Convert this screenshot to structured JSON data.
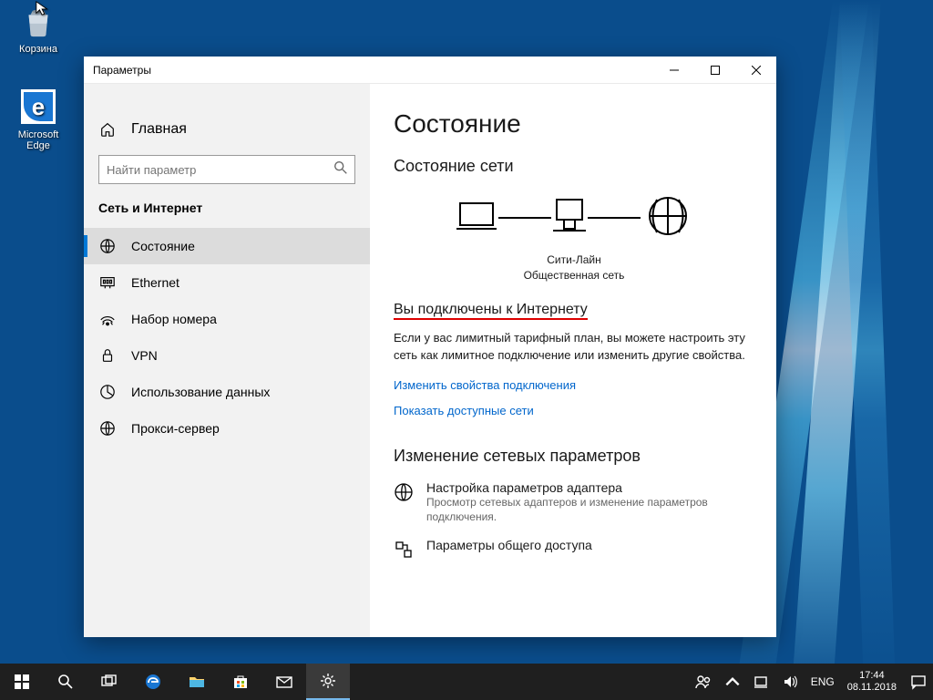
{
  "desktop": {
    "recycle_label": "Корзина",
    "edge_label": "Microsoft Edge"
  },
  "window": {
    "title": "Параметры",
    "home": "Главная",
    "search_placeholder": "Найти параметр",
    "category": "Сеть и Интернет",
    "nav": {
      "status": "Состояние",
      "ethernet": "Ethernet",
      "dialup": "Набор номера",
      "vpn": "VPN",
      "data_usage": "Использование данных",
      "proxy": "Прокси-сервер"
    }
  },
  "main": {
    "title": "Состояние",
    "subtitle": "Состояние сети",
    "diag_name": "Сити-Лайн",
    "diag_type": "Общественная сеть",
    "connected_heading": "Вы подключены к Интернету",
    "connected_body": "Если у вас лимитный тарифный план, вы можете настроить эту сеть как лимитное подключение или изменить другие свойства.",
    "link1": "Изменить свойства подключения",
    "link2": "Показать доступные сети",
    "change_heading": "Изменение сетевых параметров",
    "adapter_title": "Настройка параметров адаптера",
    "adapter_body": "Просмотр сетевых адаптеров и изменение параметров подключения.",
    "sharing_title": "Параметры общего доступа"
  },
  "taskbar": {
    "lang": "ENG",
    "time": "17:44",
    "date": "08.11.2018"
  }
}
